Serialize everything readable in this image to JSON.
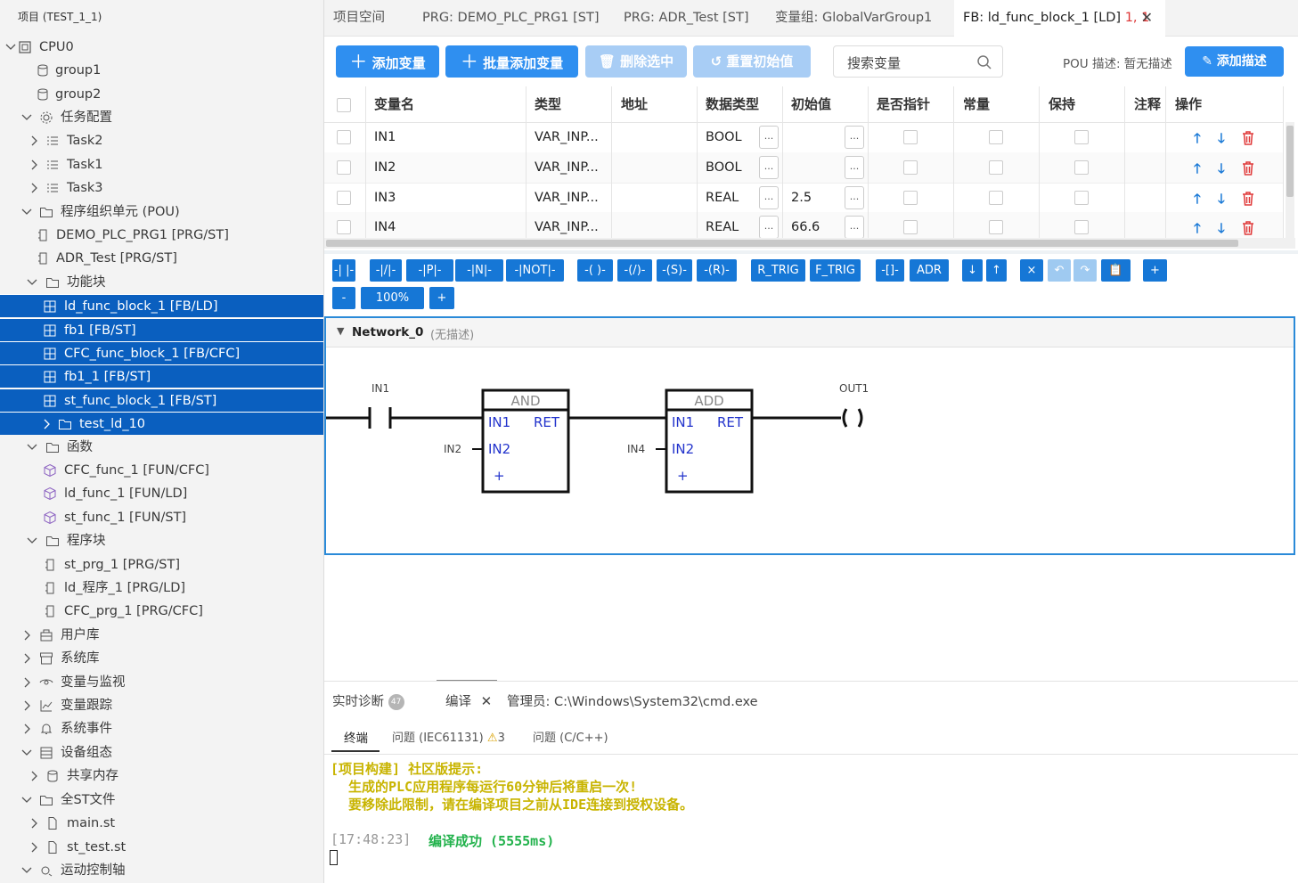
{
  "sidebar": {
    "project_title": "项目 (TEST_1_1)",
    "tree": [
      {
        "label": "CPU0",
        "toggle": "⌵",
        "icon": "cpu-icon"
      },
      {
        "label": "group1",
        "toggle": "",
        "icon": "database-icon"
      },
      {
        "label": "group2",
        "toggle": "",
        "icon": "database-icon"
      },
      {
        "label": "任务配置",
        "toggle": "⌵",
        "icon": "gear-icon"
      },
      {
        "label": "Task2",
        "toggle": "›",
        "icon": "task-list-icon"
      },
      {
        "label": "Task1",
        "toggle": "›",
        "icon": "task-list-icon"
      },
      {
        "label": "Task3",
        "toggle": "›",
        "icon": "task-list-icon"
      },
      {
        "label": "程序组织单元 (POU)",
        "toggle": "⌵",
        "icon": "folder-icon"
      },
      {
        "label": "DEMO_PLC_PRG1 [PRG/ST]",
        "toggle": "",
        "icon": "program-icon"
      },
      {
        "label": "ADR_Test [PRG/ST]",
        "toggle": "",
        "icon": "program-icon"
      },
      {
        "label": "功能块",
        "toggle": "⌵",
        "icon": "folder-icon"
      },
      {
        "label": "ld_func_block_1 [FB/LD]",
        "toggle": "",
        "icon": "function-block-icon"
      },
      {
        "label": "fb1 [FB/ST]",
        "toggle": "",
        "icon": "function-block-icon"
      },
      {
        "label": "CFC_func_block_1 [FB/CFC]",
        "toggle": "",
        "icon": "function-block-icon"
      },
      {
        "label": "fb1_1 [FB/ST]",
        "toggle": "",
        "icon": "function-block-icon"
      },
      {
        "label": "st_func_block_1 [FB/ST]",
        "toggle": "",
        "icon": "function-block-icon"
      },
      {
        "label": "test_ld_10",
        "toggle": "›",
        "icon": "folder-icon"
      },
      {
        "label": "函数",
        "toggle": "⌵",
        "icon": "folder-icon"
      },
      {
        "label": "CFC_func_1 [FUN/CFC]",
        "toggle": "",
        "icon": "function-cube-icon"
      },
      {
        "label": "ld_func_1 [FUN/LD]",
        "toggle": "",
        "icon": "function-cube-icon"
      },
      {
        "label": "st_func_1 [FUN/ST]",
        "toggle": "",
        "icon": "function-cube-icon"
      },
      {
        "label": "程序块",
        "toggle": "⌵",
        "icon": "folder-icon"
      },
      {
        "label": "st_prg_1 [PRG/ST]",
        "toggle": "",
        "icon": "program-icon"
      },
      {
        "label": "ld_程序_1 [PRG/LD]",
        "toggle": "",
        "icon": "program-icon"
      },
      {
        "label": "CFC_prg_1 [PRG/CFC]",
        "toggle": "",
        "icon": "program-icon"
      },
      {
        "label": "用户库",
        "toggle": "›",
        "icon": "library-icon"
      },
      {
        "label": "系统库",
        "toggle": "›",
        "icon": "archive-icon"
      },
      {
        "label": "变量与监视",
        "toggle": "›",
        "icon": "eye-icon"
      },
      {
        "label": "变量跟踪",
        "toggle": "›",
        "icon": "chart-line-icon"
      },
      {
        "label": "系统事件",
        "toggle": "›",
        "icon": "bell-icon"
      },
      {
        "label": "设备组态",
        "toggle": "⌵",
        "icon": "device-icon"
      },
      {
        "label": "共享内存",
        "toggle": "›",
        "icon": "database-icon"
      },
      {
        "label": "全ST文件",
        "toggle": "⌵",
        "icon": "folder-icon"
      },
      {
        "label": "main.st",
        "toggle": "›",
        "icon": "file-icon"
      },
      {
        "label": "st_test.st",
        "toggle": "›",
        "icon": "file-icon"
      },
      {
        "label": "运动控制轴",
        "toggle": "⌵",
        "icon": "axis-gear-icon"
      }
    ]
  },
  "tabs": [
    {
      "label": "项目空间"
    },
    {
      "label": "PRG: DEMO_PLC_PRG1 [ST]"
    },
    {
      "label": "PRG: ADR_Test [ST]"
    },
    {
      "label": "变量组: GlobalVarGroup1"
    },
    {
      "label": "FB: ld_func_block_1 [LD]",
      "extra": "1, 1"
    }
  ],
  "toolbar": {
    "add_var": "添加变量",
    "batch_add": "批量添加变量",
    "delete_sel": "删除选中",
    "reset_init": "重置初始值",
    "search_placeholder": "搜索变量",
    "pou_desc_label": "POU 描述:",
    "pou_desc_value": "暂无描述",
    "add_desc": "添加描述"
  },
  "var_table": {
    "headers": [
      "变量名",
      "类型",
      "地址",
      "数据类型",
      "初始值",
      "是否指针",
      "常量",
      "保持",
      "注释",
      "操作"
    ],
    "rows": [
      {
        "name": "IN1",
        "kind": "VAR_INP...",
        "address": "",
        "dtype": "BOOL",
        "init": ""
      },
      {
        "name": "IN2",
        "kind": "VAR_INP...",
        "address": "",
        "dtype": "BOOL",
        "init": ""
      },
      {
        "name": "IN3",
        "kind": "VAR_INP...",
        "address": "",
        "dtype": "REAL",
        "init": "2.5"
      },
      {
        "name": "IN4",
        "kind": "VAR_INP...",
        "address": "",
        "dtype": "REAL",
        "init": "66.6"
      }
    ],
    "dots": "..."
  },
  "ld_toolbar": {
    "buttons": [
      "-| |-",
      "-|/|-",
      "-|P|-",
      "-|N|-",
      "-|NOT|-",
      "-( )-",
      "-(/)-",
      "-(S)-",
      "-(R)-",
      "R_TRIG",
      "F_TRIG",
      "-[]-",
      "ADR",
      "↓",
      "↑",
      "×",
      "↶",
      "↷",
      "📋",
      "+"
    ],
    "zoom_minus": "-",
    "zoom": "100%",
    "zoom_plus": "+"
  },
  "network": {
    "name": "Network_0",
    "desc": "(无描述)",
    "contact_label": "IN1",
    "coil_label": "OUT1",
    "block1": {
      "title": "AND",
      "in1": "IN1",
      "in2": "IN2",
      "ret": "RET",
      "plus": "+",
      "in2_var": "IN2"
    },
    "block2": {
      "title": "ADD",
      "in1": "IN1",
      "in2": "IN2",
      "ret": "RET",
      "plus": "+",
      "in2_var": "IN4"
    }
  },
  "bottom": {
    "tab_diag": "实时诊断",
    "diag_badge": "47",
    "tab_compile": "编译",
    "tab_cmd": "管理员: C:\\Windows\\System32\\cmd.exe",
    "sub_terminal": "终端",
    "sub_iec": "问题 (IEC61131)",
    "iec_count": "3",
    "sub_cpp": "问题 (C/C++)",
    "line1": "[项目构建] 社区版提示:",
    "line2": "生成的PLC应用程序每运行60分钟后将重启一次!",
    "line3": "要移除此限制，请在编译项目之前从IDE连接到授权设备。",
    "time": "[17:48:23]",
    "success": "编译成功 (5555ms)"
  },
  "colors": {
    "accent": "#2f8ff0",
    "selected": "#0a5fbf",
    "warn_text": "#c8b400",
    "success": "#22b24c",
    "danger": "#e03a3a"
  }
}
